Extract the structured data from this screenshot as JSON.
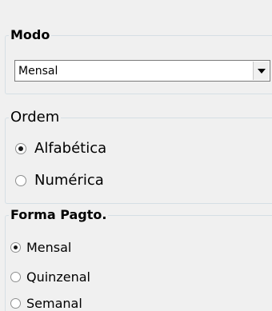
{
  "modo": {
    "legend": "Modo",
    "select_value": "Mensal"
  },
  "ordem": {
    "legend": "Ordem",
    "options": [
      {
        "label": "Alfabética",
        "checked": true
      },
      {
        "label": "Numérica",
        "checked": false
      }
    ]
  },
  "forma_pagto": {
    "legend": "Forma Pagto.",
    "options": [
      {
        "label": "Mensal",
        "checked": true
      },
      {
        "label": "Quinzenal",
        "checked": false
      },
      {
        "label": "Semanal",
        "checked": false
      }
    ]
  }
}
